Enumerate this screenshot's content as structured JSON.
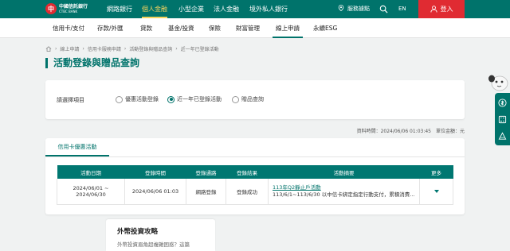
{
  "brand": {
    "name_zh": "中國信託銀行",
    "name_en": "CTBC BANK"
  },
  "topnav": [
    {
      "label": "網路銀行"
    },
    {
      "label": "個人金融"
    },
    {
      "label": "小型企業"
    },
    {
      "label": "法人金融"
    },
    {
      "label": "境外私人銀行"
    }
  ],
  "header": {
    "service_label": "服務據點",
    "lang_label": "EN",
    "login_label": "登入"
  },
  "subnav": [
    {
      "label": "信用卡/支付"
    },
    {
      "label": "存款/外匯"
    },
    {
      "label": "貸款"
    },
    {
      "label": "基金/投資"
    },
    {
      "label": "保險"
    },
    {
      "label": "財富管理"
    },
    {
      "label": "線上申請"
    },
    {
      "label": "永續ESG"
    }
  ],
  "breadcrumb": [
    "線上申請",
    "信用卡服務申請",
    "活動登錄與贈品查詢",
    "近一年已登錄活動"
  ],
  "page_title": "活動登錄與贈品查詢",
  "selector": {
    "label": "請選擇項目",
    "options": [
      {
        "label": "優惠活動登錄"
      },
      {
        "label": "近一年已登錄活動"
      },
      {
        "label": "贈品查詢"
      }
    ],
    "selected_index": 1
  },
  "info_line": "資料時間：2024/06/06 01:03:45　單位金額：元",
  "tab_label": "信用卡優惠活動",
  "table": {
    "headers": [
      "活動日期",
      "登錄時間",
      "登錄通路",
      "登錄結果",
      "活動摘要",
      "更多"
    ],
    "rows": [
      {
        "date": "2024/06/01 ~ 2024/06/30",
        "time": "2024/06/06 01:03",
        "channel": "網路登錄",
        "result": "登錄成功",
        "title": "113年Q2靜止戶活動",
        "desc": "113/6/1~113/6/30 以中信卡綁定指定行動支付，累積消費滿..."
      }
    ]
  },
  "promo": {
    "title": "外幣投資攻略",
    "subtitle": "外幣投資眉角超複雜困惑？這篇"
  },
  "colors": {
    "brand_green": "#00736b",
    "accent_red": "#e02b32",
    "active_yellow": "#f4d35e"
  },
  "icons": [
    "location-pin-icon",
    "search-icon",
    "user-icon",
    "home-icon",
    "chevron-down-icon",
    "coin-icon",
    "calculator-icon",
    "triangle-icon"
  ]
}
